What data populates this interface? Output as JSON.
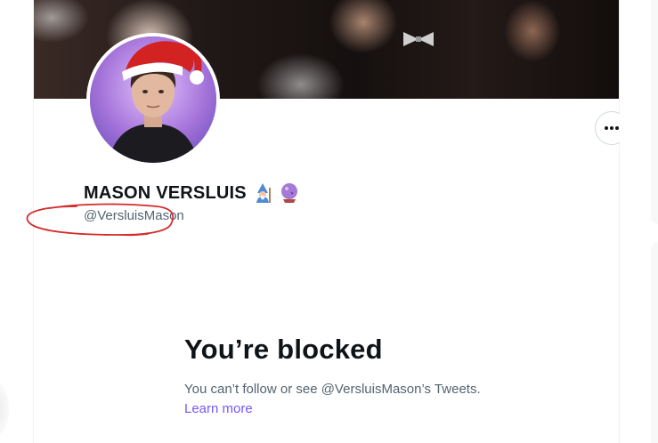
{
  "profile": {
    "display_name": "MASON VERSLUIS",
    "name_emojis": [
      "mage-emoji",
      "crystal-ball-emoji"
    ],
    "handle": "@VersluisMason",
    "more_icon": "ellipsis-icon"
  },
  "blocked": {
    "title": "You’re blocked",
    "body": "You can’t follow or see @VersluisMason’s Tweets.",
    "learn_more": "Learn more"
  },
  "colors": {
    "link": "#7856ff",
    "text_primary": "#0f1419",
    "text_secondary": "#536471",
    "annotation_red": "#d42b2b"
  }
}
